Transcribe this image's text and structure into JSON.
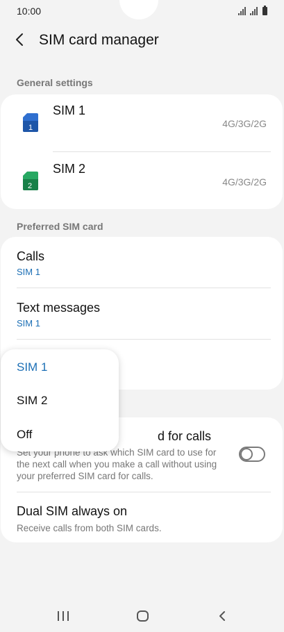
{
  "status": {
    "time": "10:00"
  },
  "header": {
    "title": "SIM card manager"
  },
  "general": {
    "label": "General settings",
    "sims": [
      {
        "name": "SIM 1",
        "number": "1",
        "network": "4G/3G/2G",
        "color": "#2f6fcf"
      },
      {
        "name": "SIM 2",
        "number": "2",
        "network": "4G/3G/2G",
        "color": "#1f9a55"
      }
    ]
  },
  "preferred": {
    "label": "Preferred SIM card",
    "items": [
      {
        "title": "Calls",
        "value": "SIM 1"
      },
      {
        "title": "Text messages",
        "value": "SIM 1"
      }
    ]
  },
  "more": {
    "confirm": {
      "title_visible": "d for calls",
      "desc_line1": "Set your phone to ask which SIM card to use for",
      "desc_line2": "the next call when you make a call without using",
      "desc_line3": "your preferred SIM card for calls.",
      "toggle_on": false
    },
    "dual": {
      "title": "Dual SIM always on",
      "desc": "Receive calls from both SIM cards."
    }
  },
  "popup": {
    "options": [
      "SIM 1",
      "SIM 2",
      "Off"
    ],
    "selected": "SIM 1",
    "selected_color": "#1c6fb5"
  },
  "colors": {
    "accent": "#1c6fb5",
    "background": "#f3f3f3"
  }
}
